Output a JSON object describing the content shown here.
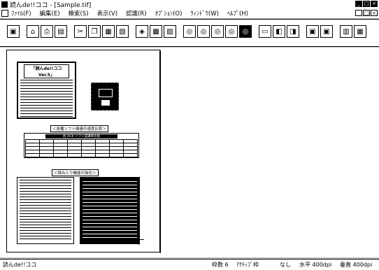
{
  "window": {
    "title": "読んde!!ココ - [Sample.tif]",
    "minimize": "_",
    "maximize": "□",
    "close": "×"
  },
  "menu": [
    "ﾌｧｲﾙ(F)",
    "編集(E)",
    "検索(S)",
    "表示(V)",
    "認識(R)",
    "ｵﾌﾟｼｮﾝ(O)",
    "ｳｨﾝﾄﾞｳ(W)",
    "ﾍﾙﾌﾟ(H)"
  ],
  "toolbar_icons": [
    "scan-icon",
    "open-icon",
    "print-icon",
    "save-icon",
    "cut-icon",
    "copy-icon",
    "paste-icon",
    "paste-special-icon",
    "eraser-icon",
    "select-icon",
    "magic-icon",
    "zoom-fit-icon",
    "zoom-in-icon",
    "zoom-out-icon",
    "zoom-full-icon",
    "zoom-actual-icon",
    "page-icon",
    "page-left-icon",
    "page-right-icon",
    "frame-icon",
    "frame2-icon",
    "column-icon",
    "table-icon",
    "image-icon",
    "text-vert-icon",
    "help-icon"
  ],
  "document": {
    "header_title": "「読んde!!ココ Ver.5」",
    "section2_title": "＜各種ソフト関連の速度比較＞",
    "section3_title": "＜読みとり機能の強化＞",
    "table_title": "各 OCR ソフト認識率比較",
    "sub1": "各種の自動認識モデル",
    "sub2": "自動修正サポート",
    "sub3": "全自動認識処理"
  },
  "status": {
    "app": "読んde!!ココ",
    "frames": "枠数 6",
    "active": "ｱｸﾃｨﾌﾞ枠",
    "none": "なし",
    "horiz": "水平 400dpi",
    "vert": "垂直 400dpi"
  }
}
